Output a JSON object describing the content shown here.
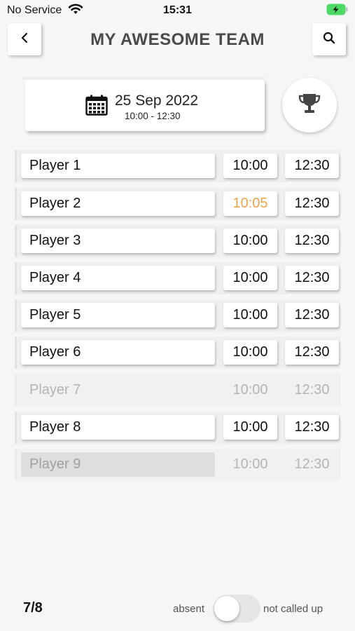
{
  "status_bar": {
    "carrier": "No Service",
    "time": "15:31"
  },
  "header": {
    "title": "MY AWESOME TEAM"
  },
  "event": {
    "date": "25 Sep 2022",
    "time_range": "10:00 - 12:30"
  },
  "players": [
    {
      "name": "Player 1",
      "start": "10:00",
      "end": "12:30",
      "state": "present"
    },
    {
      "name": "Player 2",
      "start": "10:05",
      "end": "12:30",
      "state": "late"
    },
    {
      "name": "Player 3",
      "start": "10:00",
      "end": "12:30",
      "state": "present"
    },
    {
      "name": "Player 4",
      "start": "10:00",
      "end": "12:30",
      "state": "present"
    },
    {
      "name": "Player 5",
      "start": "10:00",
      "end": "12:30",
      "state": "present"
    },
    {
      "name": "Player 6",
      "start": "10:00",
      "end": "12:30",
      "state": "present"
    },
    {
      "name": "Player 7",
      "start": "10:00",
      "end": "12:30",
      "state": "absent"
    },
    {
      "name": "Player 8",
      "start": "10:00",
      "end": "12:30",
      "state": "present"
    },
    {
      "name": "Player 9",
      "start": "10:00",
      "end": "12:30",
      "state": "not_called_up"
    }
  ],
  "footer": {
    "count": "7/8",
    "toggle_left_label": "absent",
    "toggle_right_label": "not called up"
  },
  "icons": {
    "back": "chevron-left-icon",
    "search": "search-icon",
    "calendar": "calendar-icon",
    "trophy": "trophy-icon",
    "wifi": "wifi-icon",
    "battery": "battery-charging-icon"
  },
  "colors": {
    "late_time": "#eda346",
    "battery": "#4cd964",
    "title": "#4a4a4a"
  }
}
